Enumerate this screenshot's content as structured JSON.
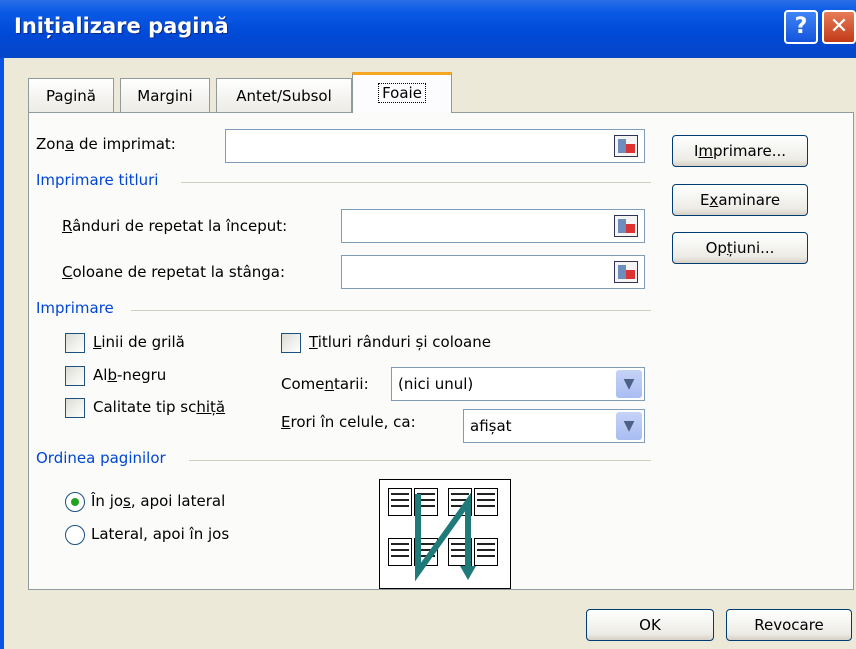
{
  "window": {
    "title": "Inițializare pagină",
    "help_label": "?",
    "close_label": "✕"
  },
  "tabs": [
    {
      "label": "Pagină"
    },
    {
      "label": "Margini"
    },
    {
      "label": "Antet/Subsol"
    },
    {
      "label": "Foaie"
    }
  ],
  "print_area": {
    "label_pre": "Zon",
    "label_key": "a",
    "label_post": " de imprimat:",
    "value": ""
  },
  "print_titles": {
    "group_label": "Imprimare titluri",
    "rows": {
      "label_key": "R",
      "label_post": "ânduri de repetat la început:",
      "value": ""
    },
    "cols": {
      "label_key": "C",
      "label_post": "oloane de repetat la stânga:",
      "value": ""
    }
  },
  "print": {
    "group_label": "Imprimare",
    "gridlines": {
      "label_key": "L",
      "label_post": "inii de grilă",
      "checked": false
    },
    "bw": {
      "label_pre": "Al",
      "label_key": "b",
      "label_post": "-negru",
      "checked": false
    },
    "draft": {
      "label_pre": "Calitate tip sc",
      "label_key": "hiță",
      "label_post": "",
      "checked": false
    },
    "headings": {
      "label_key": "T",
      "label_post": "itluri rânduri și coloane",
      "checked": false
    },
    "comments": {
      "label_pre": "Come",
      "label_key": "n",
      "label_post": "tarii:",
      "value": "(nici unul)"
    },
    "errors": {
      "label_key": "E",
      "label_post": "rori în celule, ca:",
      "value": "afișat"
    }
  },
  "page_order": {
    "group_label": "Ordinea paginilor",
    "down_then_over": {
      "label_pre": "În jo",
      "label_key": "s",
      "label_post": ", apoi lateral",
      "selected": true
    },
    "over_then_down": {
      "label_pre": "Lateral, apoi în ",
      "label_key": "j",
      "label_post": "os",
      "selected": false
    }
  },
  "side_buttons": {
    "print": {
      "pre": "I",
      "key": "m",
      "post": "primare..."
    },
    "preview": {
      "pre": "E",
      "key": "x",
      "post": "aminare"
    },
    "options": {
      "pre": "Op",
      "key": "ț",
      "post": "iuni..."
    }
  },
  "footer": {
    "ok_label": "OK",
    "cancel_label": "Revocare"
  },
  "colors": {
    "titlebar": "#0a5ae6",
    "group_text": "#0046d5",
    "active_tab_accent": "#f5a623",
    "dialog_bg": "#ece9d8",
    "arrow": "#1f7a7a"
  },
  "icons": {
    "ref_button": "range-selector-icon",
    "dropdown": "chevron-down-icon",
    "page_order": "page-order-diagram-icon"
  }
}
